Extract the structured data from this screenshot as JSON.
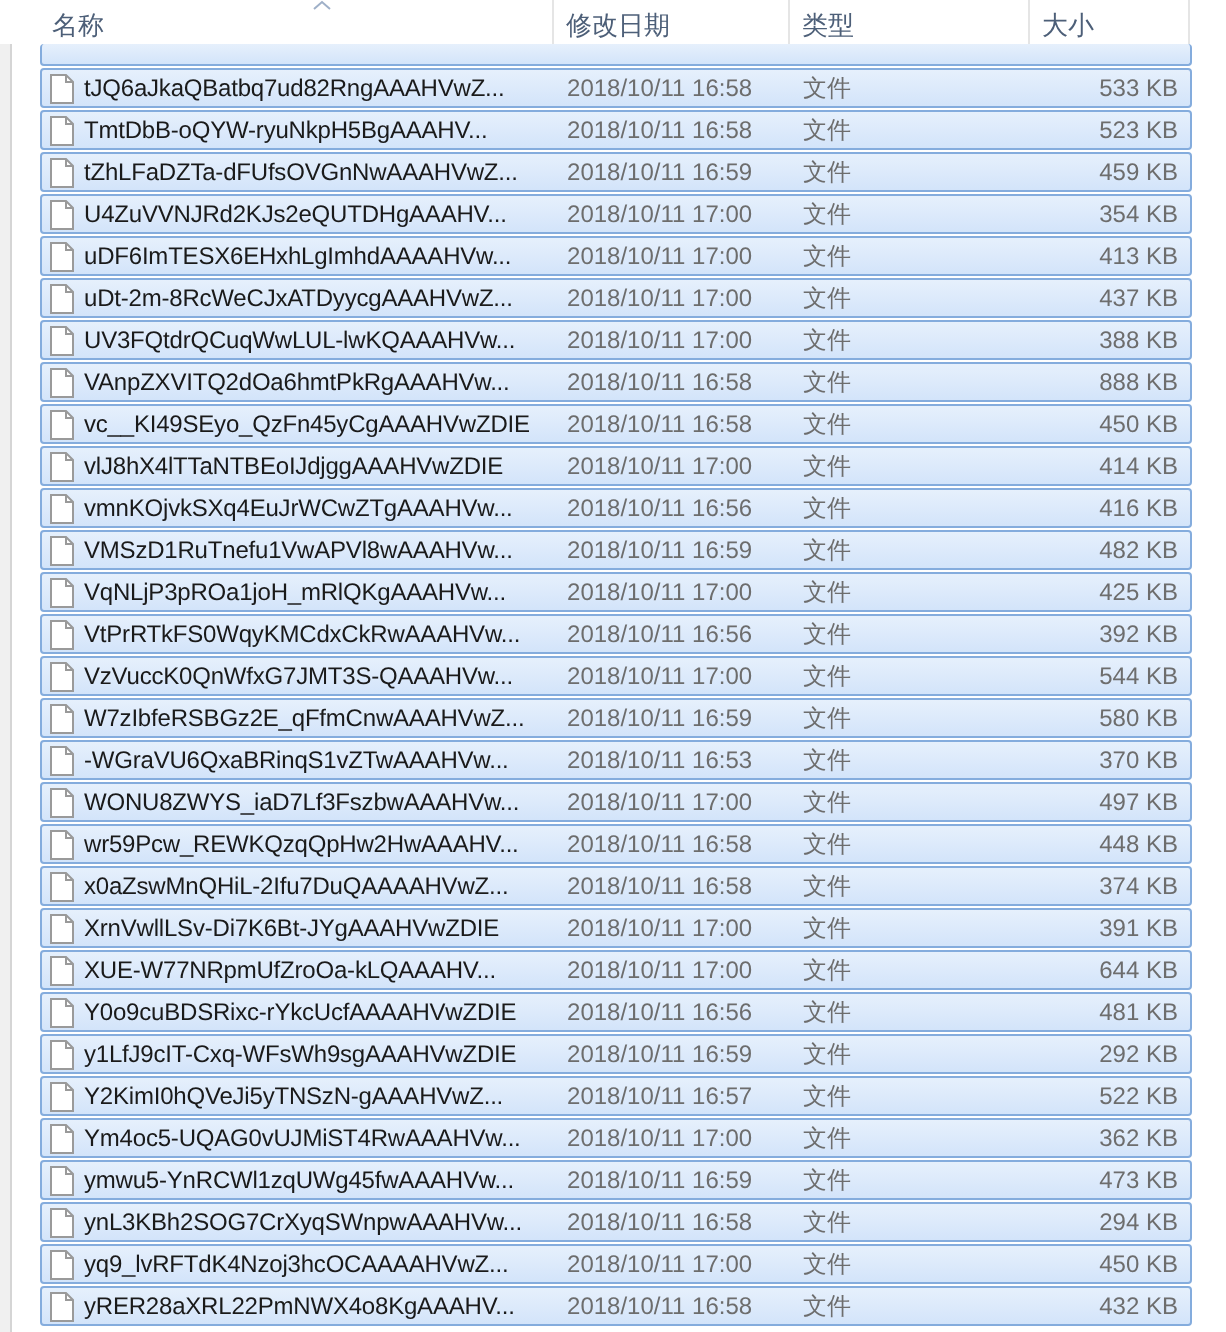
{
  "columns": [
    {
      "label": "名称",
      "sorted": true
    },
    {
      "label": "修改日期",
      "sorted": false
    },
    {
      "label": "类型",
      "sorted": false
    },
    {
      "label": "大小",
      "sorted": false
    }
  ],
  "partial_row": {
    "selected": true
  },
  "rows": [
    {
      "name": "tJQ6aJkaQBatbq7ud82RngAAAHVwZ...",
      "date": "2018/10/11 16:58",
      "type": "文件",
      "size": "533 KB",
      "selected": true
    },
    {
      "name": "TmtDbB-oQYW-ryuNkpH5BgAAAHV...",
      "date": "2018/10/11 16:58",
      "type": "文件",
      "size": "523 KB",
      "selected": true
    },
    {
      "name": "tZhLFaDZTa-dFUfsOVGnNwAAAHVwZ...",
      "date": "2018/10/11 16:59",
      "type": "文件",
      "size": "459 KB",
      "selected": true
    },
    {
      "name": "U4ZuVVNJRd2KJs2eQUTDHgAAAHV...",
      "date": "2018/10/11 17:00",
      "type": "文件",
      "size": "354 KB",
      "selected": true
    },
    {
      "name": "uDF6ImTESX6EHxhLgImhdAAAAHVw...",
      "date": "2018/10/11 17:00",
      "type": "文件",
      "size": "413 KB",
      "selected": true
    },
    {
      "name": "uDt-2m-8RcWeCJxATDyycgAAAHVwZ...",
      "date": "2018/10/11 17:00",
      "type": "文件",
      "size": "437 KB",
      "selected": true
    },
    {
      "name": "UV3FQtdrQCuqWwLUL-lwKQAAAHVw...",
      "date": "2018/10/11 17:00",
      "type": "文件",
      "size": "388 KB",
      "selected": true
    },
    {
      "name": "VAnpZXVITQ2dOa6hmtPkRgAAAHVw...",
      "date": "2018/10/11 16:58",
      "type": "文件",
      "size": "888 KB",
      "selected": true
    },
    {
      "name": "vc__KI49SEyo_QzFn45yCgAAAHVwZDIE",
      "date": "2018/10/11 16:58",
      "type": "文件",
      "size": "450 KB",
      "selected": true
    },
    {
      "name": "vlJ8hX4lTTaNTBEoIJdjggAAAHVwZDIE",
      "date": "2018/10/11 17:00",
      "type": "文件",
      "size": "414 KB",
      "selected": true
    },
    {
      "name": "vmnKOjvkSXq4EuJrWCwZTgAAAHVw...",
      "date": "2018/10/11 16:56",
      "type": "文件",
      "size": "416 KB",
      "selected": true
    },
    {
      "name": "VMSzD1RuTnefu1VwAPVl8wAAAHVw...",
      "date": "2018/10/11 16:59",
      "type": "文件",
      "size": "482 KB",
      "selected": true
    },
    {
      "name": "VqNLjP3pROa1joH_mRlQKgAAAHVw...",
      "date": "2018/10/11 17:00",
      "type": "文件",
      "size": "425 KB",
      "selected": true
    },
    {
      "name": "VtPrRTkFS0WqyKMCdxCkRwAAAHVw...",
      "date": "2018/10/11 16:56",
      "type": "文件",
      "size": "392 KB",
      "selected": true
    },
    {
      "name": "VzVuccK0QnWfxG7JMT3S-QAAAHVw...",
      "date": "2018/10/11 17:00",
      "type": "文件",
      "size": "544 KB",
      "selected": true
    },
    {
      "name": "W7zIbfeRSBGz2E_qFfmCnwAAAHVwZ...",
      "date": "2018/10/11 16:59",
      "type": "文件",
      "size": "580 KB",
      "selected": true
    },
    {
      "name": "-WGraVU6QxaBRinqS1vZTwAAAHVw...",
      "date": "2018/10/11 16:53",
      "type": "文件",
      "size": "370 KB",
      "selected": true
    },
    {
      "name": "WONU8ZWYS_iaD7Lf3FszbwAAAHVw...",
      "date": "2018/10/11 17:00",
      "type": "文件",
      "size": "497 KB",
      "selected": true
    },
    {
      "name": "wr59Pcw_REWKQzqQpHw2HwAAAHV...",
      "date": "2018/10/11 16:58",
      "type": "文件",
      "size": "448 KB",
      "selected": true
    },
    {
      "name": "x0aZswMnQHiL-2Ifu7DuQAAAAHVwZ...",
      "date": "2018/10/11 16:58",
      "type": "文件",
      "size": "374 KB",
      "selected": true
    },
    {
      "name": "XrnVwllLSv-Di7K6Bt-JYgAAAHVwZDIE",
      "date": "2018/10/11 17:00",
      "type": "文件",
      "size": "391 KB",
      "selected": true
    },
    {
      "name": "XUE-W77NRpmUfZroOa-kLQAAAHV...",
      "date": "2018/10/11 17:00",
      "type": "文件",
      "size": "644 KB",
      "selected": true
    },
    {
      "name": "Y0o9cuBDSRixc-rYkcUcfAAAAHVwZDIE",
      "date": "2018/10/11 16:56",
      "type": "文件",
      "size": "481 KB",
      "selected": true
    },
    {
      "name": "y1LfJ9cIT-Cxq-WFsWh9sgAAAHVwZDIE",
      "date": "2018/10/11 16:59",
      "type": "文件",
      "size": "292 KB",
      "selected": true
    },
    {
      "name": "Y2KimI0hQVeJi5yTNSzN-gAAAHVwZ...",
      "date": "2018/10/11 16:57",
      "type": "文件",
      "size": "522 KB",
      "selected": true
    },
    {
      "name": "Ym4oc5-UQAG0vUJMiST4RwAAAHVw...",
      "date": "2018/10/11 17:00",
      "type": "文件",
      "size": "362 KB",
      "selected": true
    },
    {
      "name": "ymwu5-YnRCWl1zqUWg45fwAAAHVw...",
      "date": "2018/10/11 16:59",
      "type": "文件",
      "size": "473 KB",
      "selected": true
    },
    {
      "name": "ynL3KBh2SOG7CrXyqSWnpwAAAHVw...",
      "date": "2018/10/11 16:58",
      "type": "文件",
      "size": "294 KB",
      "selected": true
    },
    {
      "name": "yq9_lvRFTdK4Nzoj3hcOCAAAAHVwZ...",
      "date": "2018/10/11 17:00",
      "type": "文件",
      "size": "450 KB",
      "selected": true
    },
    {
      "name": "yRER28aXRL22PmNWX4o8KgAAAHV...",
      "date": "2018/10/11 16:58",
      "type": "文件",
      "size": "432 KB",
      "selected": true
    }
  ]
}
